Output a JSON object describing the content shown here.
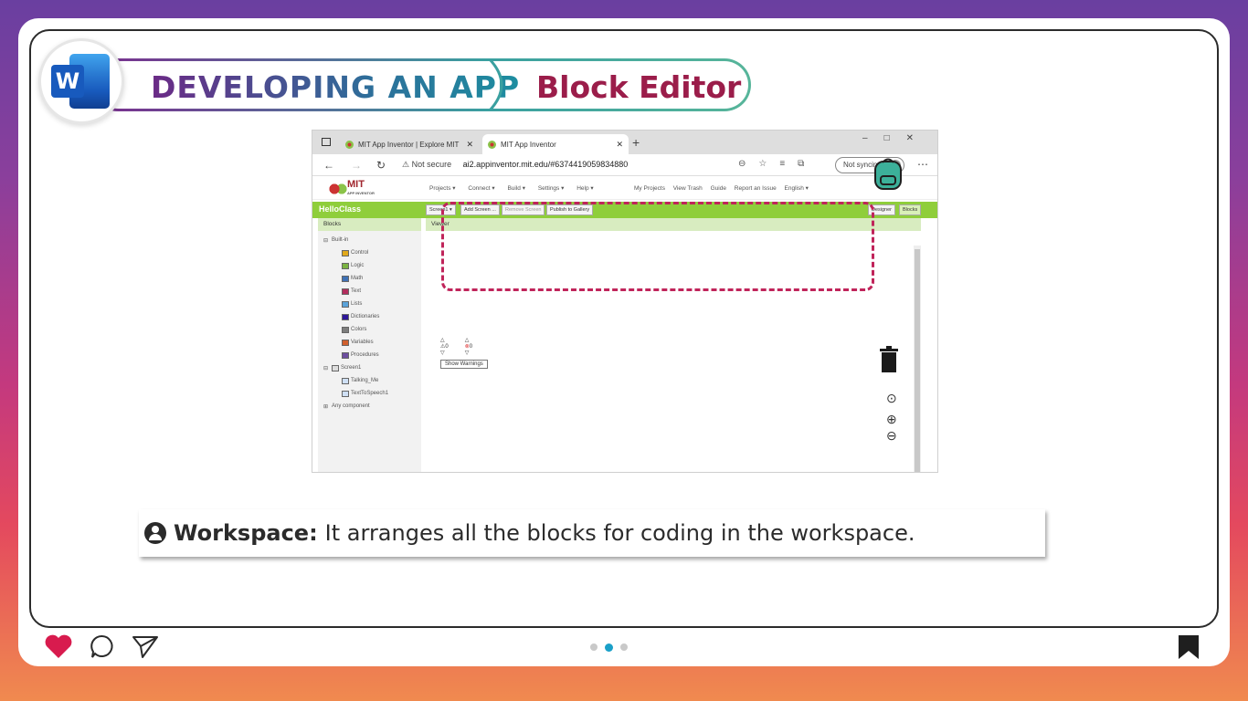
{
  "header": {
    "title_left": "DEVELOPING AN APP",
    "title_right": "Block Editor",
    "app_icon_letter": "W"
  },
  "browser": {
    "tabs": [
      {
        "label": "MIT App Inventor | Explore MIT"
      },
      {
        "label": "MIT App Inventor"
      }
    ],
    "address": {
      "security": "Not secure",
      "url": "ai2.appinventor.mit.edu/#6374419059834880",
      "sync_label": "Not syncing"
    },
    "app_inventor": {
      "logo_text": "MIT",
      "logo_sub": "APP INVENTOR",
      "menu": [
        "Projects ▾",
        "Connect ▾",
        "Build ▾",
        "Settings ▾",
        "Help ▾"
      ],
      "right_menu": [
        "My Projects",
        "View Trash",
        "Guide",
        "Report an Issue",
        "English ▾"
      ],
      "project_name": "HelloClass",
      "toolbar": [
        "Screen1 ▾",
        "Add Screen ...",
        "Remove Screen",
        "Publish to Gallery"
      ],
      "mode_buttons": [
        "Designer",
        "Blocks"
      ],
      "blocks_header": "Blocks",
      "viewer_header": "Viewer",
      "tree": {
        "builtin": "Built-in",
        "items": [
          {
            "label": "Control",
            "color": "#e1a91b"
          },
          {
            "label": "Logic",
            "color": "#7bb342"
          },
          {
            "label": "Math",
            "color": "#3f71b5"
          },
          {
            "label": "Text",
            "color": "#b32d5e"
          },
          {
            "label": "Lists",
            "color": "#5ba3da"
          },
          {
            "label": "Dictionaries",
            "color": "#2d1799"
          },
          {
            "label": "Colors",
            "color": "#7d7d7d"
          },
          {
            "label": "Variables",
            "color": "#d05f2d"
          },
          {
            "label": "Procedures",
            "color": "#6e4fa0"
          }
        ],
        "screen": "Screen1",
        "components": [
          "Talking_Me",
          "TextToSpeech1"
        ],
        "any_component": "Any component"
      },
      "warnings": {
        "warn_count": "0",
        "error_count": "0",
        "show_label": "Show Warnings"
      }
    }
  },
  "caption": {
    "term": "Workspace:",
    "text": "It arranges all the blocks for coding in the workspace."
  },
  "footer": {
    "dots_active_index": 1
  },
  "colors": {
    "accent": "#c0245a",
    "title_right": "#9b1d4a",
    "dot_active": "#1aa0c8"
  }
}
